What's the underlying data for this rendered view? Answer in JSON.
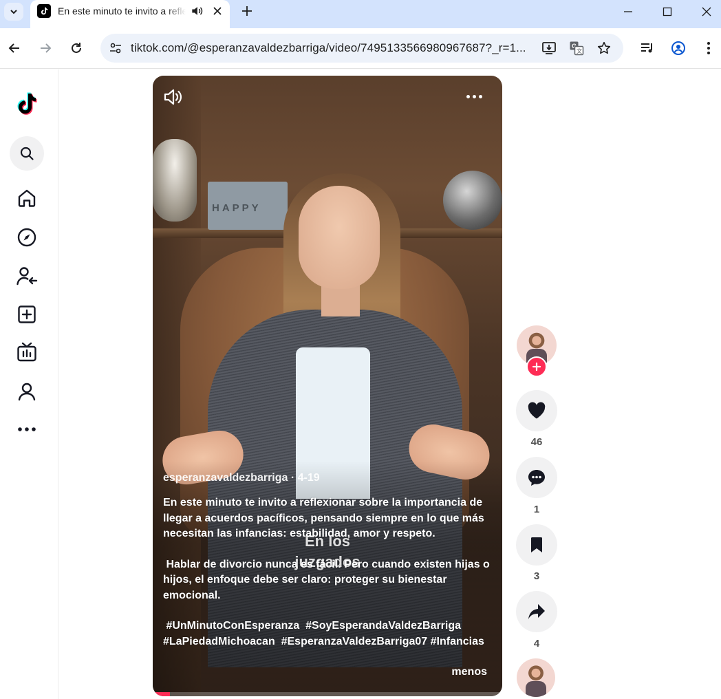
{
  "browser": {
    "tab": {
      "title": "En este minuto te invito a reflexionar sobre la importancia"
    },
    "url": "tiktok.com/@esperanzavaldezbarriga/video/7495133566980967687?_r=1..."
  },
  "sidebar": {
    "items": [
      "tiktok-logo",
      "search-icon",
      "home-icon",
      "explore-icon",
      "following-icon",
      "upload-icon",
      "live-icon",
      "profile-icon",
      "more-icon"
    ]
  },
  "video": {
    "author": "esperanzavaldezbarriga",
    "date": "4-19",
    "separator": "·",
    "description": [
      "En este minuto te invito a reflexionar sobre la importancia de llegar a acuerdos pacíficos, pensando siempre en lo que más necesitan las infancias: estabilidad, amor y respeto.",
      " Hablar de divorcio nunca es fácil. Pero cuando existen hijas o hijos, el enfoque debe ser claro: proteger su bienestar emocional.",
      " #UnMinutoConEsperanza  #SoyEsperandaValdezBarriga #LaPiedadMichoacan  #EsperanzaValdezBarriga07 #Infancias"
    ],
    "less_label": "menos",
    "burned_caption_line1": "En los",
    "burned_caption_line2": "juzgados",
    "backdrop_sign": "HAPPY",
    "progress_percent": 5
  },
  "actions": {
    "likes": "46",
    "comments": "1",
    "saves": "3",
    "shares": "4"
  },
  "colors": {
    "accent": "#fe2c55",
    "tabstrip": "#d3e3fd",
    "omnibox": "#edf2fa"
  }
}
